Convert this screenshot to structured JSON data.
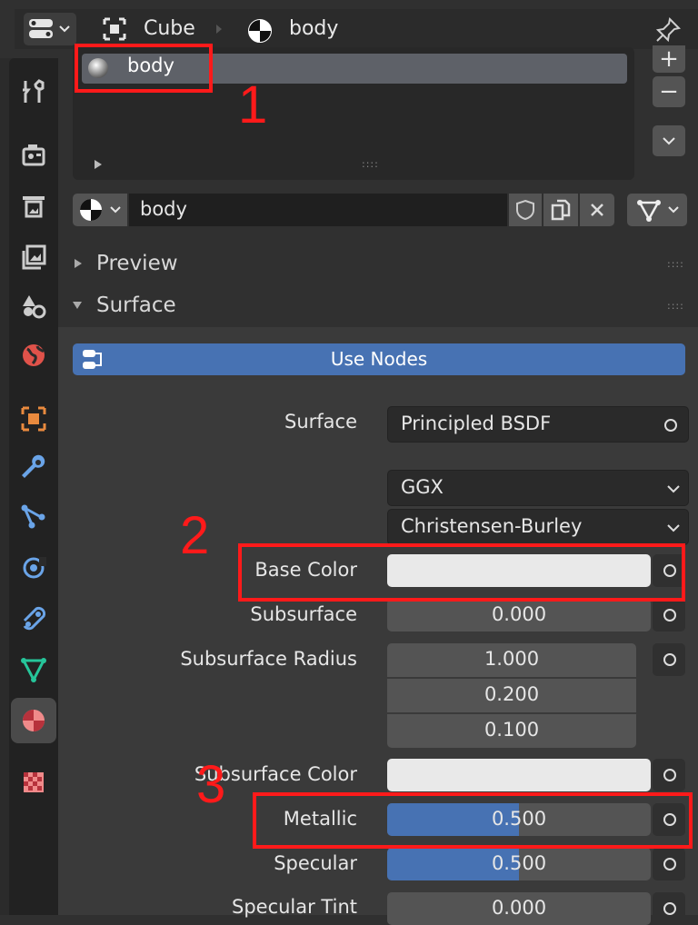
{
  "header": {
    "object_name": "Cube",
    "material_name": "body"
  },
  "slots": {
    "selected_label": "body",
    "add_label": "+",
    "remove_label": "−",
    "grip": "::::"
  },
  "datablock": {
    "name": "body"
  },
  "sections": {
    "preview": "Preview",
    "surface": "Surface",
    "grip": "::::"
  },
  "use_nodes_label": "Use Nodes",
  "properties": {
    "surface_label": "Surface",
    "surface_value": "Principled BSDF",
    "distribution": "GGX",
    "subsurface_method": "Christensen-Burley",
    "base_color_label": "Base Color",
    "subsurface_label": "Subsurface",
    "subsurface_value": "0.000",
    "subsurface_radius_label": "Subsurface Radius",
    "subsurface_radius": [
      "1.000",
      "0.200",
      "0.100"
    ],
    "subsurface_color_label": "Subsurface Color",
    "metallic_label": "Metallic",
    "metallic_value": "0.500",
    "metallic_fraction": 0.5,
    "specular_label": "Specular",
    "specular_value": "0.500",
    "specular_fraction": 0.5,
    "specular_tint_label": "Specular Tint",
    "specular_tint_value": "0.000"
  },
  "annotations": {
    "n1": "1",
    "n2": "2",
    "n3": "3",
    "color": "#ff1a1a"
  },
  "colors": {
    "accent_blue": "#4772b3",
    "slider_blue": "#4772b3",
    "panel": "#303030",
    "field": "#545454"
  }
}
